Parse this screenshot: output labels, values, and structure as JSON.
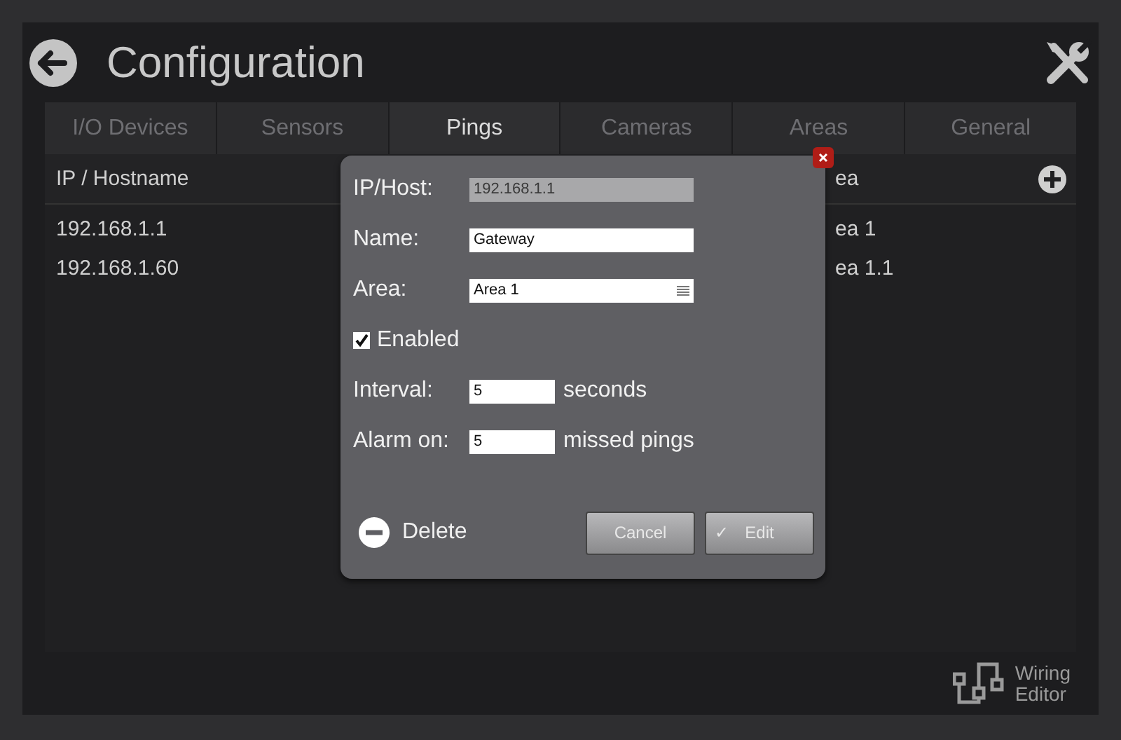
{
  "header": {
    "title": "Configuration"
  },
  "tabs": [
    {
      "label": "I/O Devices",
      "selected": false
    },
    {
      "label": "Sensors",
      "selected": false
    },
    {
      "label": "Pings",
      "selected": true
    },
    {
      "label": "Cameras",
      "selected": false
    },
    {
      "label": "Areas",
      "selected": false
    },
    {
      "label": "General",
      "selected": false
    }
  ],
  "table": {
    "columns": [
      "IP / Hostname",
      "ea"
    ],
    "rows": [
      [
        "192.168.1.1",
        "ea 1"
      ],
      [
        "192.168.1.60",
        "ea 1.1"
      ]
    ]
  },
  "dialog": {
    "fields": [
      {
        "kind": "readonly",
        "label": "IP/Host:",
        "value": "192.168.1.1"
      },
      {
        "kind": "text",
        "label": "Name:",
        "value": "Gateway"
      },
      {
        "kind": "select",
        "label": "Area:",
        "value": "Area 1"
      },
      {
        "kind": "checkbox",
        "label": "Enabled",
        "checked": true
      },
      {
        "kind": "number",
        "label": "Interval:",
        "value": "5",
        "unit": "seconds"
      },
      {
        "kind": "number",
        "label": "Alarm on:",
        "value": "5",
        "unit": "missed pings"
      }
    ],
    "delete_label": "Delete",
    "cancel_label": "Cancel",
    "edit_label": "Edit",
    "edit_glyph": "✓"
  },
  "footer": {
    "label_lines": [
      "Wiring",
      "Editor"
    ]
  }
}
